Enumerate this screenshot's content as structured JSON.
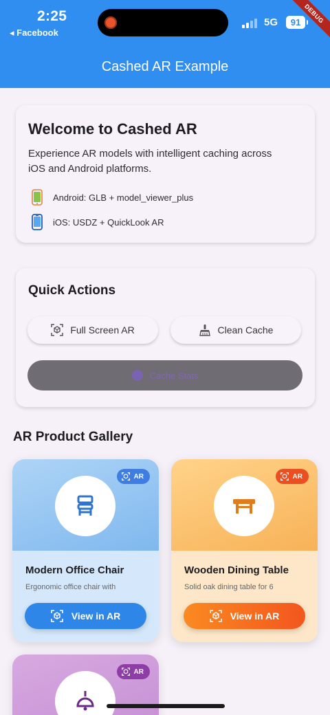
{
  "status_bar": {
    "time": "2:25",
    "back_app": "◂ Facebook",
    "network": "5G",
    "battery": "91"
  },
  "debug_banner": "DEBUG",
  "app_bar": {
    "title": "Cashed AR Example"
  },
  "welcome": {
    "title": "Welcome to Cashed AR",
    "description": "Experience AR models with intelligent caching across iOS and Android platforms.",
    "platforms": [
      {
        "icon": "android-phone-icon",
        "label": "Android: GLB + model_viewer_plus"
      },
      {
        "icon": "ios-phone-icon",
        "label": "iOS: USDZ + QuickLook AR"
      }
    ]
  },
  "quick_actions": {
    "title": "Quick Actions",
    "full_screen_label": "Full Screen AR",
    "clean_cache_label": "Clean Cache",
    "disabled_label": "Cache Stats"
  },
  "gallery": {
    "title": "AR Product Gallery",
    "products": [
      {
        "name": "Modern Office Chair",
        "description": "Ergonomic office chair with",
        "badge": "AR",
        "button": "View in AR",
        "icon": "chair-icon"
      },
      {
        "name": "Wooden Dining Table",
        "description": "Solid oak dining table for 6",
        "badge": "AR",
        "button": "View in AR",
        "icon": "table-icon"
      },
      {
        "badge": "AR",
        "icon": "lamp-icon"
      }
    ]
  },
  "colors": {
    "app_bar": "#2f8ef0",
    "chair_accent": "#2e86e8",
    "table_accent": "#f2561d",
    "lamp_accent": "#8e3da6"
  }
}
